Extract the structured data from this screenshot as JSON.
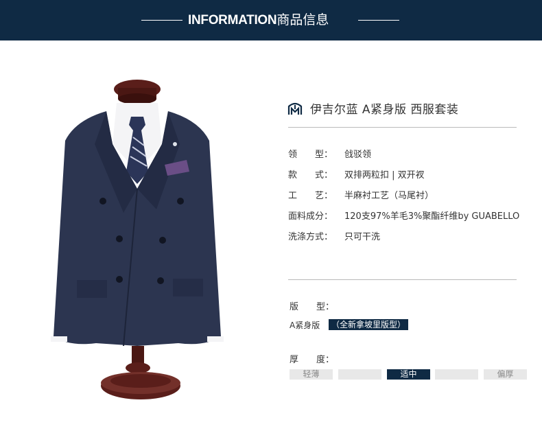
{
  "header": {
    "title_en": "INFORMATION",
    "title_cn": "商品信息"
  },
  "product": {
    "title": "伊吉尔蓝 A紧身版 西服套装",
    "brand_icon": "brand-logo-icon"
  },
  "specs": [
    {
      "label": "领　　型：",
      "value": "戗驳领"
    },
    {
      "label": "款　　式：",
      "value": "双排两粒扣 | 双开衩"
    },
    {
      "label": "工　　艺：",
      "value": "半麻衬工艺（马尾衬）"
    },
    {
      "label": "面料成分：",
      "value": "120支97%羊毛3%聚酯纤维by GUABELLO"
    },
    {
      "label": "洗涤方式：",
      "value": "只可干洗"
    }
  ],
  "fit": {
    "label": "版　　型：",
    "value": "A紧身版",
    "badge": "（全新拿坡里版型）"
  },
  "thickness": {
    "label": "厚　　度：",
    "options": [
      "轻薄",
      "",
      "适中",
      "",
      "偏厚"
    ],
    "selected": "适中"
  },
  "colors": {
    "header_bg": "#0f2a44",
    "suit": "#2c3550",
    "mannequin": "#5a1e1a",
    "divider": "#b9b9b9"
  }
}
